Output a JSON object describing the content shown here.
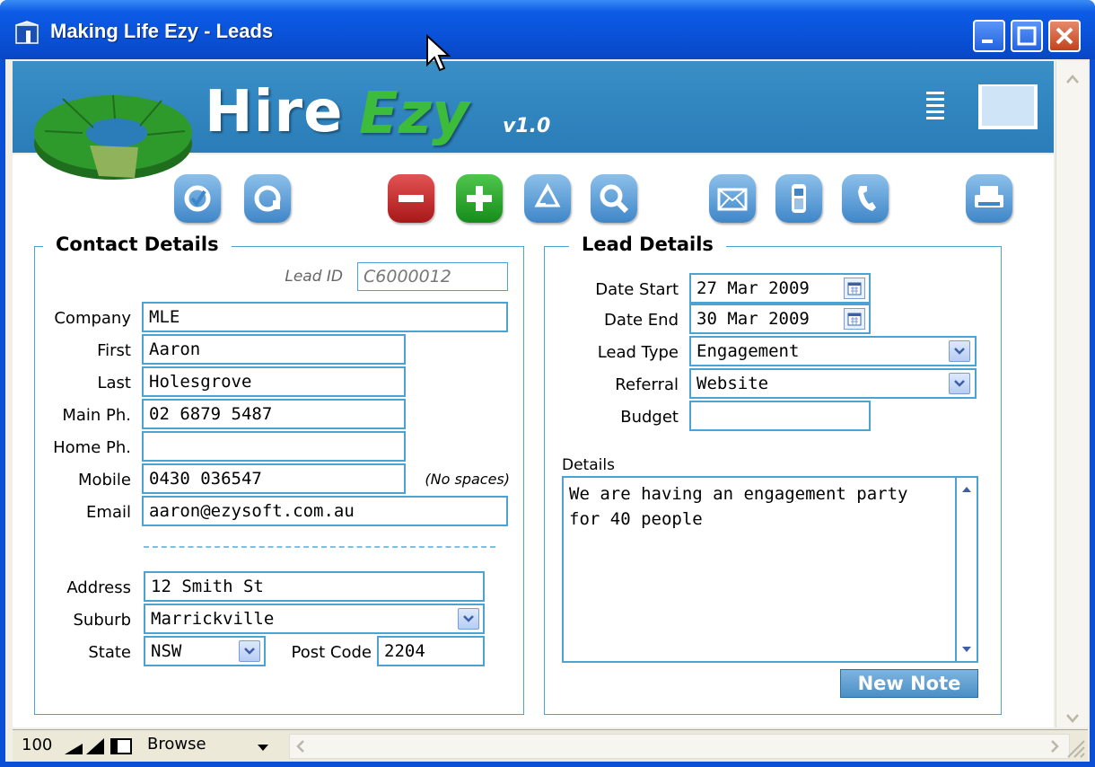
{
  "window": {
    "title": "Making Life Ezy - Leads"
  },
  "banner": {
    "brand_hire": "Hire",
    "brand_ezy": "Ezy",
    "version": "v1.0"
  },
  "toolbar": {
    "icons": [
      "check-icon",
      "refresh-icon",
      "delete-icon",
      "add-icon",
      "recycle-icon",
      "search-icon",
      "email-icon",
      "mobile-icon",
      "phone-icon",
      "print-icon"
    ]
  },
  "contact": {
    "title": "Contact Details",
    "lead_id_label": "Lead ID",
    "lead_id": "C6000012",
    "company_label": "Company",
    "company": "MLE",
    "first_label": "First",
    "first": "Aaron",
    "last_label": "Last",
    "last": "Holesgrove",
    "main_ph_label": "Main Ph.",
    "main_ph": "02 6879 5487",
    "home_ph_label": "Home Ph.",
    "home_ph": "",
    "mobile_label": "Mobile",
    "mobile": "0430 036547",
    "mobile_hint": "(No spaces)",
    "email_label": "Email",
    "email": "aaron@ezysoft.com.au",
    "address_label": "Address",
    "address": "12 Smith St",
    "suburb_label": "Suburb",
    "suburb": "Marrickville",
    "state_label": "State",
    "state": "NSW",
    "postcode_label": "Post Code",
    "postcode": "2204"
  },
  "lead": {
    "title": "Lead Details",
    "date_start_label": "Date Start",
    "date_start": "27 Mar 2009",
    "date_end_label": "Date End",
    "date_end": "30 Mar 2009",
    "lead_type_label": "Lead Type",
    "lead_type": "Engagement",
    "referral_label": "Referral",
    "referral": "Website",
    "budget_label": "Budget",
    "budget": "",
    "details_label": "Details",
    "details_line1": "We are having an engagement party",
    "details_line2": "for 40 people",
    "new_note_label": "New Note"
  },
  "statusbar": {
    "zoom": "100",
    "mode": "Browse"
  },
  "colors": {
    "titlebar": "#0a52d8",
    "banner": "#2a7db8",
    "field_border": "#4aa3d3",
    "brand_green": "#3dbb3a"
  }
}
